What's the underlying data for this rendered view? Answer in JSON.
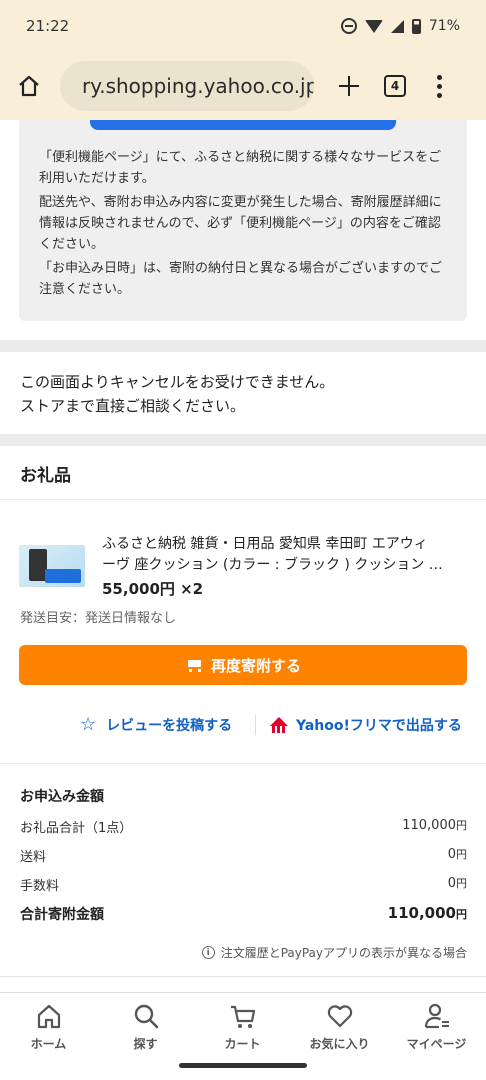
{
  "status": {
    "time": "21:22",
    "battery": "71%"
  },
  "browser": {
    "url": "ry.shopping.yahoo.co.jp",
    "tab_count": "4"
  },
  "info_box": {
    "paragraphs": [
      "「便利機能ページ」にて、ふるさと納税に関する様々なサービスをご利用いただけます。",
      "配送先や、寄附お申込み内容に変更が発生した場合、寄附履歴詳細に情報は反映されませんので、必ず「便利機能ページ」の内容をご確認ください。",
      "「お申込み日時」は、寄附の納付日と異なる場合がございますのでご注意ください。"
    ]
  },
  "cancel_note": {
    "line1": "この画面よりキャンセルをお受けできません。",
    "line2": "ストアまで直接ご相談ください。"
  },
  "gift_section": {
    "title": "お礼品",
    "product": {
      "title_line1": "ふるさと納税 雑貨・日用品 愛知県 幸田町 エアウィ",
      "title_line2": "ーヴ 座クッション (カラー : ブラック ) クッション …",
      "price": "55,000円 ×2",
      "shipping": "発送目安：発送日情報なし"
    },
    "redonate_label": "再度寄附する",
    "review_label": "レビューを投稿する",
    "flea_label": "Yahoo!フリマで出品する"
  },
  "summary": {
    "title": "お申込み金額",
    "rows": [
      {
        "label": "お礼品合計（1点）",
        "value": "110,000",
        "unit": "円"
      },
      {
        "label": "送料",
        "value": "0",
        "unit": "円"
      },
      {
        "label": "手数料",
        "value": "0",
        "unit": "円"
      }
    ],
    "total_label": "合計寄附金額",
    "total_value": "110,000",
    "total_unit": "円",
    "notice": "注文履歴とPayPayアプリの表示が異なる場合"
  },
  "bottom_nav": {
    "items": [
      {
        "label": "ホーム",
        "icon": "home-icon"
      },
      {
        "label": "探す",
        "icon": "search-icon"
      },
      {
        "label": "カート",
        "icon": "cart-icon"
      },
      {
        "label": "お気に入り",
        "icon": "heart-icon"
      },
      {
        "label": "マイページ",
        "icon": "person-icon"
      }
    ]
  },
  "colors": {
    "accent_orange": "#ff8200",
    "link_blue": "#1060c8",
    "primary_blue": "#2470e6",
    "browser_bar": "#f9efd9"
  }
}
